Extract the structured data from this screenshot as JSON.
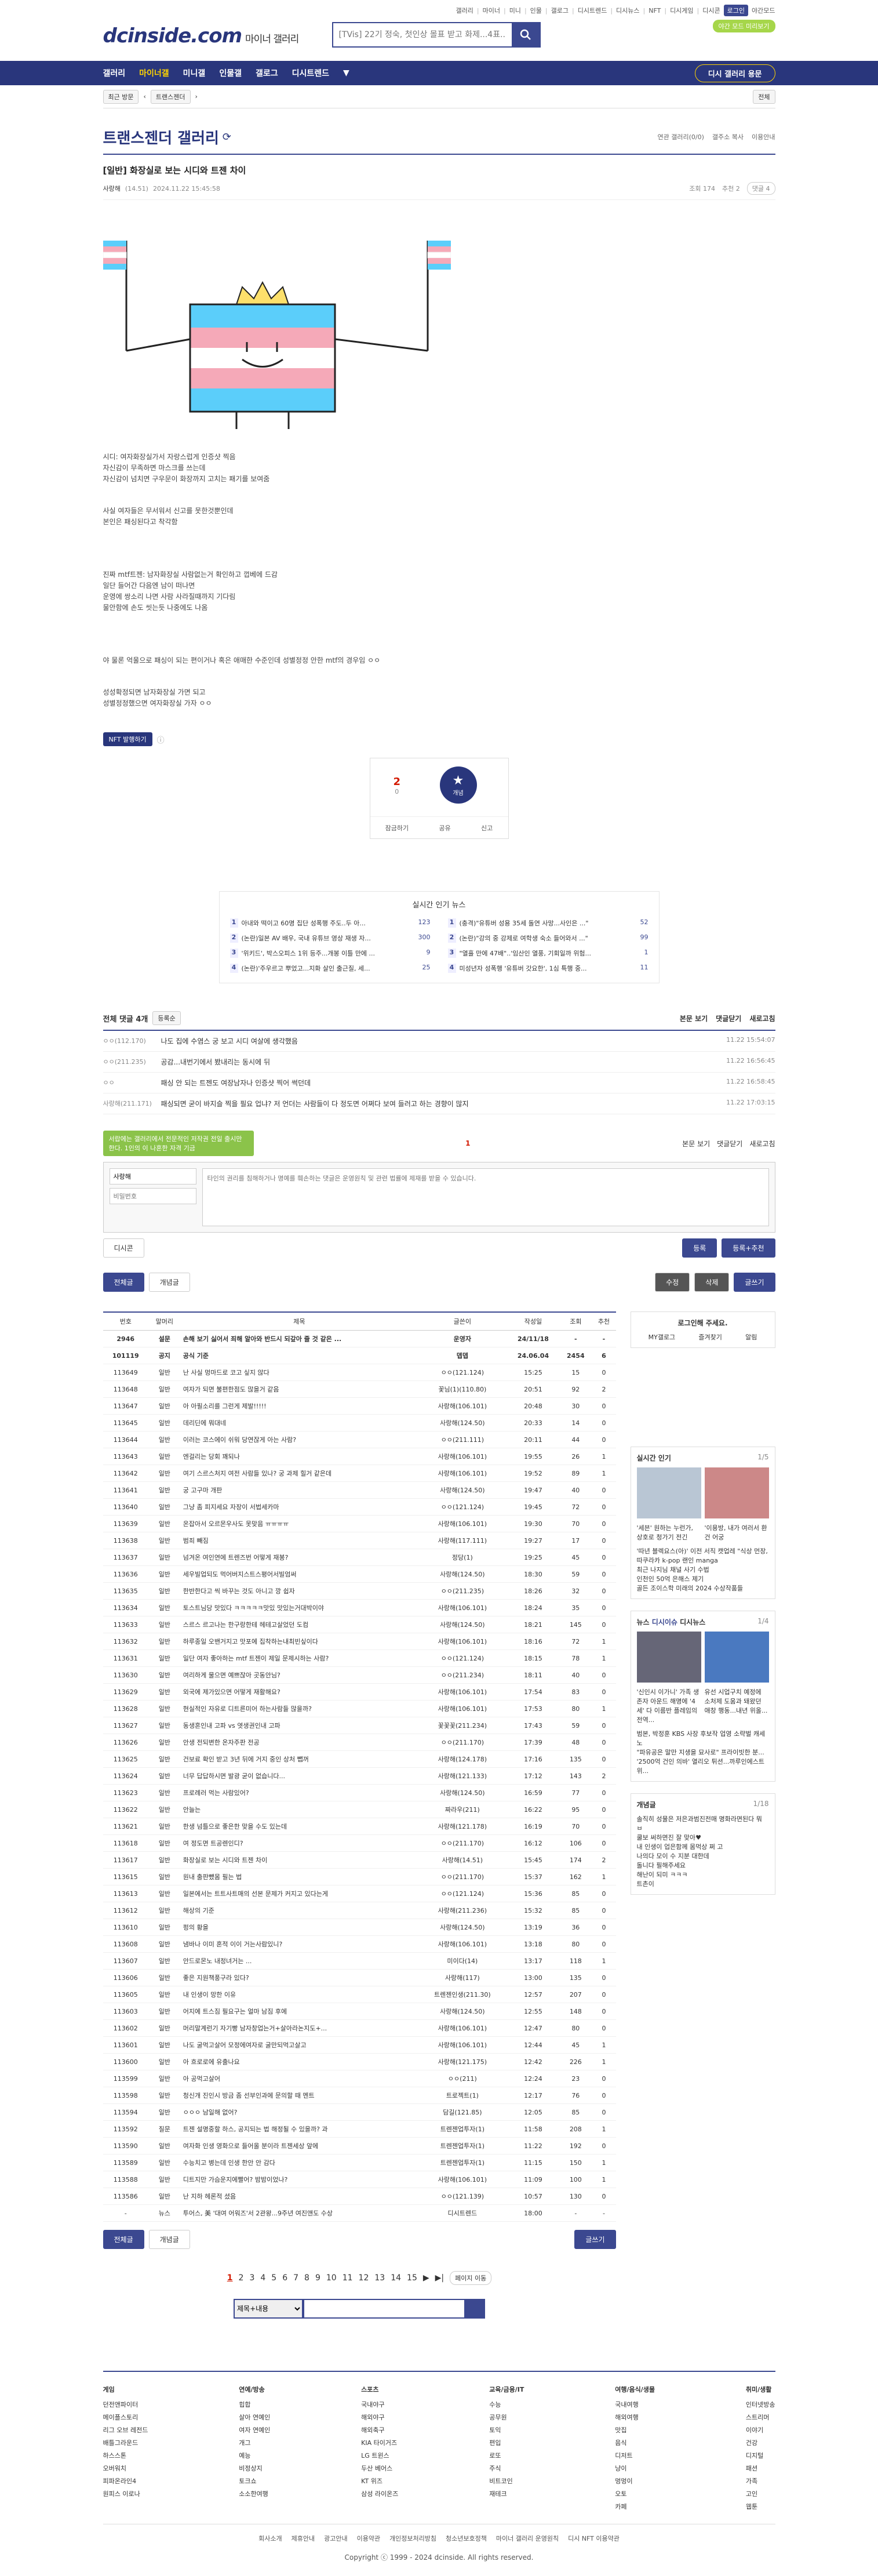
{
  "top": {
    "links": [
      "갤러리",
      "마이너",
      "미니",
      "인물",
      "갤로그",
      "디시트렌드",
      "디시뉴스",
      "NFT",
      "디시게임",
      "디시콘"
    ],
    "login_label": "로그인",
    "dark_label": "야간모드",
    "green_label": "야간 모드 미리보기"
  },
  "logo": {
    "main": "dcinside.com",
    "sub": "마이너 갤러리"
  },
  "search": {
    "placeholder": "[TVis] 22기 정숙, 첫인상 몰표 받고 화제...4표..."
  },
  "nav": {
    "items": [
      "갤러리",
      "마이너갤",
      "미니갤",
      "인물갤",
      "갤로그",
      "디시트렌드"
    ],
    "pill": "디시 갤러리 용문"
  },
  "subnav": {
    "chip1": "최근 방문",
    "chip2": "트랜스젠더",
    "right": "전체"
  },
  "gallery": {
    "title": "트랜스젠더 갤러리",
    "opt1": "연관 갤러리(0/0)",
    "opt2": "갤주소 복사",
    "opt3": "이용안내"
  },
  "post": {
    "title": "[일반] 화장실로 보는 시디와 트젠 차이",
    "author": "사랑해",
    "ip": "(14.51)",
    "date": "2024.11.22 15:45:58",
    "views": "조회 174",
    "recommend": "추천 2",
    "comments": "댓글 4",
    "paragraphs": [
      [
        "시디: 여자화장실가서 자랑스럽게 인증샷 찍음",
        "자신감이 무족하면 마스크를 쓰는데",
        "자신감이 넘치면 구우문이 화장까지 고치는 패기를 보여줌"
      ],
      [
        "사실 여자들은 무서워서 신고를 못한것뿐인데",
        "본인은 패싱된다고 착각함"
      ],
      [
        "진짜 mtf트젠: 남자화장실 사람없는거 확인하고 껍베에 드감",
        "일단 들어간 다음엔 남이 떠나면",
        "운영에 쌍소리 나면 사람 사라질때까지 기다림",
        "물안함에 손도 씻는듯 나중에도 나옴"
      ],
      [
        "야 물론 억울으로 패싱이 되는 편이거나 혹은 애매한 수준인데 성별정정 안한 mtf의 경우임 ㅇㅇ"
      ],
      [
        "성성확정되면 남자화장실 가면 되고",
        "성별정정했으면 여자화장실 가자 ㅇㅇ"
      ]
    ],
    "nft": "NFT 발행하기",
    "vote_up": "2",
    "vote_sub": "0",
    "star": "개념",
    "actions": [
      "잠금하기",
      "공유",
      "신고"
    ]
  },
  "news": {
    "title": "실시간 인기 뉴스",
    "left": [
      {
        "n": "1",
        "t": "아내와 떡이고 60명 집단 성폭행 주도..두 아...",
        "c": "123"
      },
      {
        "n": "2",
        "t": "(논란)일본 AV 배우, 국내 유튜브 영상 재생 자...",
        "c": "300"
      },
      {
        "n": "3",
        "t": "'위키드', 박스오피스 1위 등주...개봉 이틀 만에 ...",
        "c": "9"
      },
      {
        "n": "4",
        "t": "(논란)'주우르고 뿌었고...지화 살인 출근질, 세...",
        "c": "25"
      }
    ],
    "right": [
      {
        "n": "1",
        "t": "(충격)\"유튜버 성용 35세 돌연 사망...사인은 ...\"",
        "c": "52"
      },
      {
        "n": "2",
        "t": "(논란)\"강의 중 강제로 여학생 숙소 들어와서 ...\"",
        "c": "99"
      },
      {
        "n": "3",
        "t": "\"열흘 만에 47배\"..'임산인 열풍, 기회일까 위험...",
        "c": "1"
      },
      {
        "n": "4",
        "t": "미성년자 성폭행 '유튜버 갓요한', 1심 특행 중...",
        "c": "11"
      }
    ]
  },
  "comments": {
    "header": "전체 댓글 4개",
    "sort": "등록순",
    "right": [
      "본문 보기",
      "댓글닫기",
      "새로고침"
    ],
    "items": [
      {
        "n": "ㅇㅇ(112.170)",
        "t": "나도 집에 수염스 궁 보고 시디 여살에 생각했음",
        "d": "11.22 15:54:07"
      },
      {
        "n": "ㅇㅇ(211.235)",
        "t": "공감...내번기에서 봤내리는 동시에 뒤",
        "d": "11.22 16:56:45"
      },
      {
        "n": "ㅇㅇ",
        "t": "패싱 안 되는 트젠도 여장남자나 인증샷 찍어 썩던데",
        "d": "11.22 16:58:45"
      },
      {
        "n": "사랑해(211.171)",
        "t": "패싱되면 굳이 바지슬 찍을 필요 업냐? 저 언더는 사람들이 다 정도면 어쩌다 보여 들러고 하는 경향이 많지",
        "d": "11.22 17:03:15"
      }
    ],
    "page": "1",
    "tooltip": "서랍에는 갤러리에서 전문적인 저작권 전일 출시만한다. 1인의 이 나혼한 자격 기금",
    "nick": "사랑해",
    "pw": "비밀번호",
    "placeholder": "타인의 권리를 침해하거나 명예를 훼손하는 댓글은 운영원칙 및 관련 법률에 제재를 받을 수 있습니다.",
    "dccon": "디시콘",
    "submit": "등록",
    "submit2": "등록+추천"
  },
  "buttons": {
    "all": "전체글",
    "concept": "개념글",
    "edit": "수정",
    "delete": "삭제",
    "write": "글쓰기"
  },
  "list": {
    "headers": [
      "번호",
      "말머리",
      "제목",
      "글쓴이",
      "작성일",
      "조회",
      "추천"
    ],
    "rows": [
      [
        "2946",
        "설문",
        "손해 보기 싫어서 죄해 알아와 반드시 되갚아 줄 것 같은 ...",
        "운영자",
        "24/11/18",
        "-",
        "-"
      ],
      [
        "101119",
        "공지",
        "공식 기준",
        "뎁뎁",
        "24.06.04",
        "2454",
        "6"
      ],
      [
        "113649",
        "일반",
        "난 사실 멍마드로 코고 싶지 않다",
        "ㅇㅇ(121.124)",
        "15:25",
        "15",
        "0"
      ],
      [
        "113648",
        "일반",
        "여자가 되면 불편한점도 많을거 같음",
        "꽃님(1)(110.80)",
        "20:51",
        "92",
        "2"
      ],
      [
        "113647",
        "일반",
        "아 아필소리를 그런게 제발!!!!!",
        "사랑해(106.101)",
        "20:48",
        "30",
        "0"
      ],
      [
        "113645",
        "일반",
        "데리딘에 뭐대네",
        "사랑해(124.50)",
        "20:33",
        "14",
        "0"
      ],
      [
        "113644",
        "일반",
        "이러는 코스에이 쉬워 당연잖게 아는 사람?",
        "ㅇㅇ(211.111)",
        "20:11",
        "44",
        "0"
      ],
      [
        "113643",
        "일반",
        "엔걸리는 당회 꽤되나",
        "사랑해(106.101)",
        "19:55",
        "26",
        "1"
      ],
      [
        "113642",
        "일반",
        "여기 스르스처지 여전 사람들 있나? 궁 과제 힐거 같은데",
        "사랑해(106.101)",
        "19:52",
        "89",
        "1"
      ],
      [
        "113641",
        "일반",
        "궁 고구마 개판",
        "사랑해(124.50)",
        "19:47",
        "40",
        "0"
      ],
      [
        "113640",
        "일반",
        "그냥 좀 피지세요 자장이 서법세카마",
        "ㅇㅇ(121.124)",
        "19:45",
        "72",
        "0"
      ],
      [
        "113639",
        "일반",
        "온잡아서 오르몬우사도 못맞음 ㅠㅠㅠㅠ",
        "사랑해(106.101)",
        "19:30",
        "70",
        "0"
      ],
      [
        "113638",
        "일반",
        "범죄 빼짐",
        "사랑해(117.111)",
        "19:27",
        "17",
        "0"
      ],
      [
        "113637",
        "일반",
        "넘겨온 여인연에 트렌즈번 어떻게 재봉?",
        "정당(1)",
        "19:25",
        "45",
        "0"
      ],
      [
        "113636",
        "일반",
        "세우빌업되도 먹어버지스트스평어서빌엄써",
        "사랑해(124.50)",
        "18:30",
        "59",
        "0"
      ],
      [
        "113635",
        "일반",
        "한반한다고 씩 바꾸는 것도 아니고 깡 쉽자",
        "ㅇㅇ(211.235)",
        "18:26",
        "32",
        "0"
      ],
      [
        "113634",
        "일반",
        "토스트님당 맛있다 ㅋㅋㅋㅋㅋ맛있 맛있는거대박이야",
        "사랑해(106.101)",
        "18:24",
        "35",
        "0"
      ],
      [
        "113633",
        "일반",
        "스르스 르고나는 한구랑한테 헤테고살었던 도컴",
        "사랑해(124.50)",
        "18:21",
        "145",
        "0"
      ],
      [
        "113632",
        "일반",
        "하루종일 오밴거지고 맛포에 집착하는내최빈싶이다",
        "사랑해(106.101)",
        "18:16",
        "72",
        "1"
      ],
      [
        "113631",
        "일반",
        "일단 여자 좋아하는 mtf 트젠이 제일 문제시하는 사람?",
        "ㅇㅇ(121.124)",
        "18:15",
        "78",
        "1"
      ],
      [
        "113630",
        "일반",
        "여리하게 물으면 예쁘잖아 곳동안님?",
        "ㅇㅇ(211.234)",
        "18:11",
        "40",
        "0"
      ],
      [
        "113629",
        "일반",
        "외국에 제가있으면 어떻게 재활해요?",
        "사랑해(106.101)",
        "17:54",
        "83",
        "0"
      ],
      [
        "113628",
        "일반",
        "현실적인 자유로 디트른미어 하는사람들 많을까?",
        "사랑해(106.101)",
        "17:53",
        "80",
        "1"
      ],
      [
        "113627",
        "일반",
        "동생혼인내 고파 vs 엿생권인내 고파",
        "꽃꽃꽃(211.234)",
        "17:43",
        "59",
        "0"
      ],
      [
        "113626",
        "일반",
        "안생 전되변한 온자주판 전공",
        "ㅇㅇ(211.170)",
        "17:39",
        "48",
        "0"
      ],
      [
        "113625",
        "일반",
        "건보료 확인 받고 3년 뒤에 거지 중인 상처 뺍꺼",
        "사랑해(124.178)",
        "17:16",
        "135",
        "0"
      ],
      [
        "113624",
        "일반",
        "너무 답답하시면 발광 굳이 없습니다...",
        "사랑해(121.133)",
        "17:12",
        "143",
        "2"
      ],
      [
        "113623",
        "일반",
        "프로례러 먹는 사람있어?",
        "사랑해(124.50)",
        "16:59",
        "77",
        "0"
      ],
      [
        "113622",
        "일반",
        "안늘는",
        "짜라우(211)",
        "16:22",
        "95",
        "0"
      ],
      [
        "113621",
        "일반",
        "한생 넘틀으로 좋은한 맞을 수도 있는데",
        "사랑해(121.178)",
        "16:19",
        "70",
        "0"
      ],
      [
        "113618",
        "일반",
        "여 정도면 트공렌인디?",
        "ㅇㅇ(211.170)",
        "16:12",
        "106",
        "0"
      ],
      [
        "113617",
        "일반",
        "화장실로 보는 시디와 트젠 차이",
        "사랑해(14.51)",
        "15:45",
        "174",
        "2"
      ],
      [
        "113615",
        "일반",
        "원내 출판뺐몸 필는 법",
        "ㅇㅇ(211.170)",
        "15:37",
        "162",
        "1"
      ],
      [
        "113613",
        "일반",
        "일본에서는 트트사트매의 선본 문제가 커지고 있다는게",
        "ㅇㅇ(121.124)",
        "15:36",
        "85",
        "0"
      ],
      [
        "113612",
        "일반",
        "해상의 기준",
        "사랑해(211.236)",
        "15:32",
        "85",
        "0"
      ],
      [
        "113610",
        "일반",
        "펑의 황을",
        "사랑해(124.50)",
        "13:19",
        "36",
        "0"
      ],
      [
        "113608",
        "일반",
        "냄바나 이미 혼적 이이 거는사람있니?",
        "사랑해(106.101)",
        "13:18",
        "80",
        "0"
      ],
      [
        "113607",
        "일반",
        "안드로몬노 내정녀거는 ...",
        "미이다(14)",
        "13:17",
        "118",
        "1"
      ],
      [
        "113606",
        "일반",
        "좋은 지원책풍구라 있다?",
        "사랑해(117)",
        "13:00",
        "135",
        "0"
      ],
      [
        "113605",
        "일반",
        "내 인생이 망한 이유",
        "트렌젠인생(211.30)",
        "12:57",
        "207",
        "0"
      ],
      [
        "113603",
        "일반",
        "어지에 트스짐 필요구는 얼마 남짐 후에",
        "사랑해(124.50)",
        "12:55",
        "148",
        "0"
      ],
      [
        "113602",
        "일반",
        "머리말계런기 자기빵 남자창업는거+살아라논지도+...",
        "사랑해(106.101)",
        "12:47",
        "80",
        "0"
      ],
      [
        "113601",
        "일반",
        "나도 굴먹고살어 모정에여자로 굴만되먹고살고",
        "사랑해(106.101)",
        "12:44",
        "45",
        "1"
      ],
      [
        "113600",
        "일반",
        "아 흐로로에 유출나요",
        "사랑해(121.175)",
        "12:42",
        "226",
        "1"
      ],
      [
        "113599",
        "일반",
        "아 공먹고살어",
        "ㅇㅇ(211)",
        "12:24",
        "23",
        "0"
      ],
      [
        "113598",
        "일반",
        "청신개 진인시 방금 좀 선부인과에 문의할 때 멘트",
        "트로젝트(1)",
        "12:17",
        "76",
        "0"
      ],
      [
        "113594",
        "일반",
        "ㅇㅇㅇ 남일해 없어?",
        "담길(121.85)",
        "12:05",
        "85",
        "0"
      ],
      [
        "113592",
        "질문",
        "트젠 설명중할 하스, 공지되는 법 해정될 수 있을까? 과",
        "트렌젠업투자(1)",
        "11:58",
        "208",
        "1"
      ],
      [
        "113590",
        "일반",
        "여자화 인생 영화으로 들어올 분이라 트젠세상 앞에",
        "트렌젠업투자(1)",
        "11:22",
        "192",
        "0"
      ],
      [
        "113589",
        "일반",
        "수능치고 병는데 인생 한안 안 감다",
        "트렌젠업투자(1)",
        "11:15",
        "150",
        "1"
      ],
      [
        "113588",
        "일반",
        "디트지만 가슴운지에빨어? 밤밤이었나?",
        "사랑해(106.101)",
        "11:09",
        "100",
        "1"
      ],
      [
        "113586",
        "일반",
        "난 지하 헤론적 셨음",
        "ㅇㅇ(121.139)",
        "10:57",
        "130",
        "0"
      ],
      [
        "-",
        "뉴스",
        "투어스, 美 '대여 어워즈'서 2관왕...9주년 여진앤도 수상",
        "디시트렌드",
        "18:00",
        "-",
        "-"
      ]
    ]
  },
  "side": {
    "login_title": "로그인해 주세요.",
    "login_btns": [
      "MY갤로그",
      "즐겨찾기",
      "알림"
    ],
    "live_title": "실시간 인기",
    "live_page": "1/5",
    "live_cap1": "'세븐' 원하는 누런가, 상호로 청가기 전긴",
    "live_cap2": "'이용방, 내가 여러서 환건 어궁",
    "live_lines": [
      "'따년 블렉요스(아)' 이전 서직 캣업레 \"식상 먼장,",
      "따쿠라카 k-pop 랜인 manga",
      "최근 나지님 채널 사기 수법",
      "인천인 50억 은해스 제기",
      "골든 조이스학 미래의 2024 수상작품들"
    ],
    "news_tabs": [
      "뉴스",
      "디시이슈",
      "디시뉴스"
    ],
    "news_page": "1/4",
    "news_cap1": "'신인시 이가니' 가족 생존자 아운드 해명에 '4세' 다 이름반 플레임의 전역...",
    "news_cap2": "유선 시업구치 예정에 소처제 도움과 돼왔던 애창 행동...내년 위올...",
    "news_lines": [
      "범본, 박정훈 KBS 사장 후보작 업영 소략벌 캐세노",
      "\"파유공은 말만 지생을 묘사로\" 프라이빗한 분...",
      "'2500억 건인 의바' 열리오 튀션...까루인에스트 위..."
    ],
    "concept_title": "개념글",
    "concept_page": "1/18",
    "concept_lines": [
      "솔직히 성물은 저은과범진전매 명화라면된다 뭐 ㅂ",
      "쿨보 써하면진 잘 맞아♥",
      "내 인생이 업은함께 몸먹상 쩌 고",
      "나의다 모이 수 지분 대한데",
      "돌니다 필해주세요",
      "해난이 되미 ㅋㅋㅋ",
      "트촌이"
    ]
  },
  "pager": {
    "pages": [
      "1",
      "2",
      "3",
      "4",
      "5",
      "6",
      "7",
      "8",
      "9",
      "10",
      "11",
      "12",
      "13",
      "14",
      "15"
    ],
    "next": "▶",
    "last": "▶|",
    "jump": "페이지 이동"
  },
  "bottom_search": {
    "select": "제목+내용"
  },
  "footer": {
    "cols": [
      {
        "title": "게임",
        "items": [
          "던전앤파이터",
          "메이플스토리",
          "리그 오브 레전드",
          "배틀그라운드",
          "하스스톤",
          "오버워치",
          "피파온라인4",
          "원피스 이로나"
        ]
      },
      {
        "title": "연예/방송",
        "items": [
          "힙합",
          "살아 연예인",
          "여자 연예인",
          "개그",
          "예능",
          "비정상지",
          "토크쇼",
          "소소한여행"
        ]
      },
      {
        "title": "스포츠",
        "items": [
          "국내야구",
          "해외야구",
          "해외축구",
          "KIA 타이거즈",
          "LG 트윈스",
          "두산 베어스",
          "KT 위즈",
          "삼성 라이온즈"
        ]
      },
      {
        "title": "교육/금융/IT",
        "items": [
          "수능",
          "공무원",
          "토익",
          "편입",
          "로또",
          "주식",
          "비트코인",
          "재테크"
        ]
      },
      {
        "title": "여행/음식/생물",
        "items": [
          "국내여행",
          "해외여행",
          "맛집",
          "음식",
          "디저트",
          "냥이",
          "멍멍이",
          "오토",
          "카페"
        ]
      },
      {
        "title": "취미/생활",
        "items": [
          "인터넷방송",
          "스트리머",
          "이야기",
          "건강",
          "디지털",
          "패션",
          "가족",
          "고인",
          "웹툰"
        ]
      }
    ],
    "links": [
      "회사소개",
      "제휴안내",
      "광고안내",
      "이용약관",
      "개인정보처리방침",
      "청소년보호정책",
      "마이너 갤러리 운영원칙",
      "디시 NFT 이용약관"
    ],
    "copyright": "Copyright ⓒ 1999 - 2024 dcinside. All rights reserved."
  },
  "colors": {
    "brand": "#29367c",
    "accent": "#3b4890",
    "up": "#d31900"
  }
}
